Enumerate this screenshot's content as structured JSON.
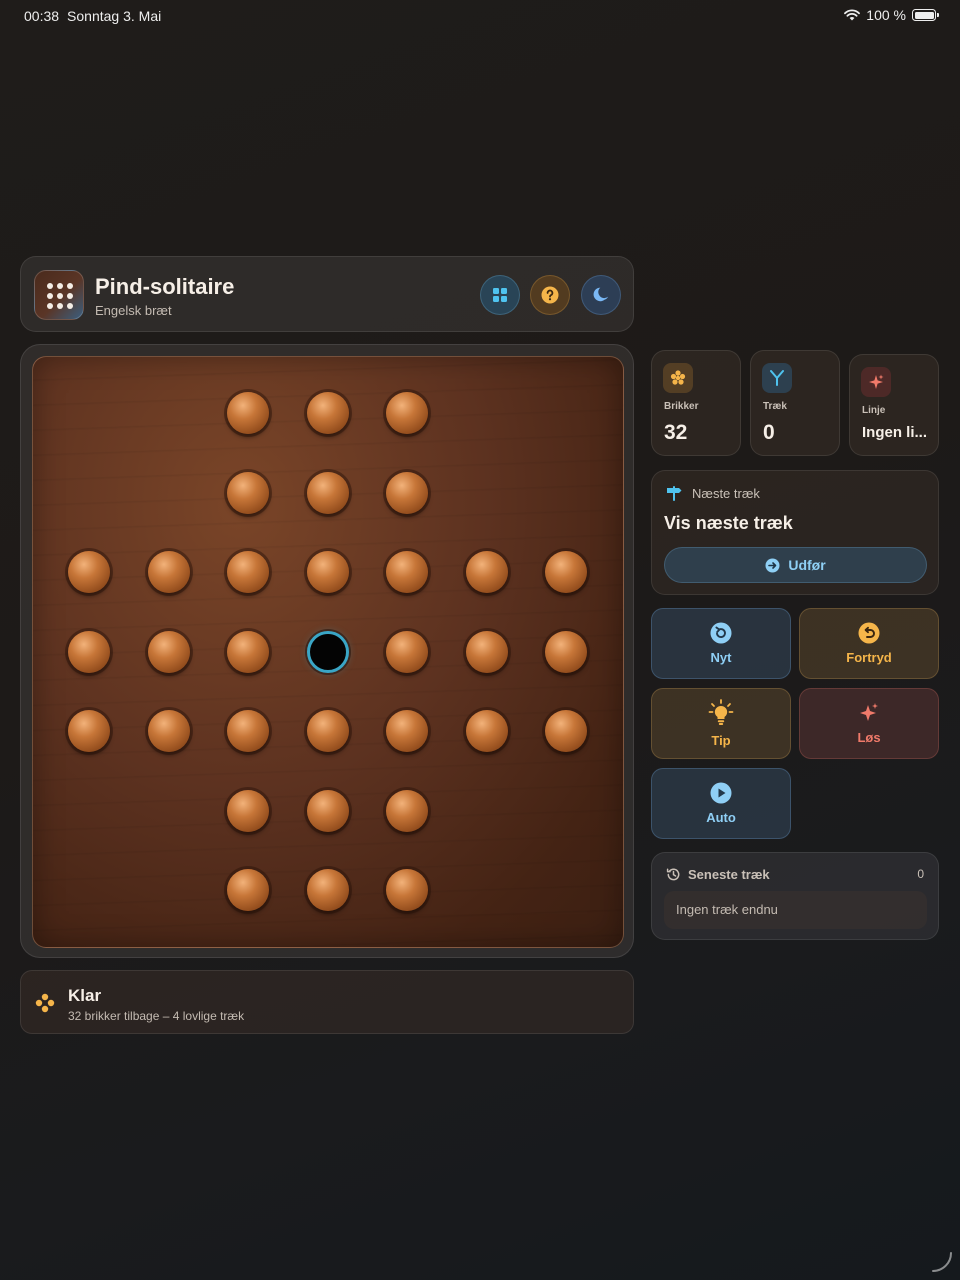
{
  "statusbar": {
    "time": "00:38",
    "date": "Sonntag 3. Mai",
    "battery": "100 %"
  },
  "header": {
    "title": "Pind-solitaire",
    "subtitle": "Engelsk bræt"
  },
  "board": {
    "layout": [
      "..XXX..",
      "..XXX..",
      "XXXXXXX",
      "XXXOXXX",
      "XXXXXXX",
      "..XXX..",
      "..XXX.."
    ]
  },
  "status": {
    "title": "Klar",
    "detail": "32 brikker tilbage – 4 lovlige træk"
  },
  "stats": [
    {
      "label": "Brikker",
      "value": "32"
    },
    {
      "label": "Træk",
      "value": "0"
    },
    {
      "label": "Linje",
      "value": "Ingen li..."
    }
  ],
  "hint": {
    "label": "Næste træk",
    "title": "Vis næste træk",
    "action": "Udfør"
  },
  "actions": {
    "new": "Nyt",
    "undo": "Fortryd",
    "tip": "Tip",
    "solve": "Løs",
    "auto": "Auto"
  },
  "recent": {
    "label": "Seneste træk",
    "count": "0",
    "empty": "Ingen træk endnu"
  },
  "colors": {
    "accent": "#3aa6c6",
    "amber": "#f5b54a",
    "red": "#f07a6a",
    "blue": "#8fcff5"
  }
}
